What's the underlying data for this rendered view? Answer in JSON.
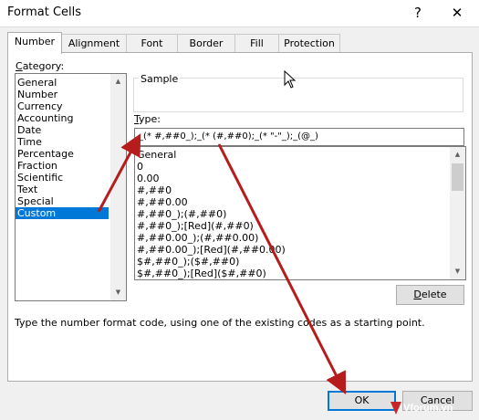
{
  "window": {
    "title": "Format Cells",
    "help_glyph": "?",
    "close_glyph": "✕"
  },
  "tabs": [
    {
      "label": "Number",
      "active": true
    },
    {
      "label": "Alignment"
    },
    {
      "label": "Font"
    },
    {
      "label": "Border"
    },
    {
      "label": "Fill"
    },
    {
      "label": "Protection"
    }
  ],
  "category": {
    "label_prefix": "C",
    "label_rest": "ategory:",
    "items": [
      "General",
      "Number",
      "Currency",
      "Accounting",
      "Date",
      "Time",
      "Percentage",
      "Fraction",
      "Scientific",
      "Text",
      "Special",
      "Custom"
    ],
    "selected": "Custom"
  },
  "sample": {
    "label": "Sample"
  },
  "type": {
    "label_prefix": "T",
    "label_rest": "ype:",
    "value": "_(* #,##0_);_(* (#,##0);_(* \"-\"_);_(@_)",
    "options": [
      "General",
      "0",
      "0.00",
      "#,##0",
      "#,##0.00",
      "#,##0_);(#,##0)",
      "#,##0_);[Red](#,##0)",
      "#,##0.00_);(#,##0.00)",
      "#,##0.00_);[Red](#,##0.00)",
      "$#,##0_);($#,##0)",
      "$#,##0_);[Red]($#,##0)"
    ]
  },
  "delete_button": {
    "label_prefix": "D",
    "label_rest": "elete"
  },
  "hint": "Type the number format code, using one of the existing codes as a starting point.",
  "ok_button": "OK",
  "cancel_button": "Cancel",
  "watermark": "Vforum.vn",
  "colors": {
    "selection": "#0078d7",
    "annotation_arrow": "#b71c1c",
    "watermark_logo": "#c62828"
  },
  "icons": {
    "scroll_up": "▲",
    "scroll_down": "▼"
  }
}
